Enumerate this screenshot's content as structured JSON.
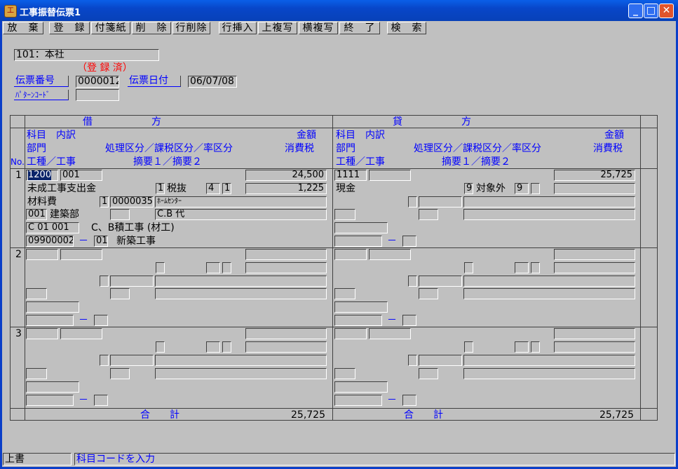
{
  "window": {
    "title": "工事振替伝票1",
    "app_icon_glyph": "工"
  },
  "toolbar": [
    "放　棄",
    "登　録",
    "付箋紙",
    "削　除",
    "行削除",
    "行挿入",
    "上複写",
    "横複写",
    "終　了",
    "検　索"
  ],
  "header": {
    "company": "101：本社",
    "status": "（登 録 済）",
    "slip_no_label": "伝票番号",
    "slip_no": "0000012",
    "slip_date_label": "伝票日付",
    "slip_date": "06/07/08",
    "pattern_code_label": "ﾊﾟﾀｰﾝｺｰﾄﾞ",
    "pattern_code": ""
  },
  "columns": {
    "debit": "借　　　　　　方",
    "credit": "貸　　　　　　方",
    "no": "No.",
    "row1_left": "科目　内訳",
    "row1_right": "金額",
    "row2_left": "部門",
    "row2_mid": "処理区分／課税区分／率区分",
    "row2_right": "消費税",
    "row3_left": "工種／工事",
    "row3_mid": "摘要１／摘要２"
  },
  "rows": [
    {
      "no": "1",
      "debit": {
        "account": "1200",
        "breakdown": "001",
        "amount": "24,500",
        "account_name": "未成工事支出金",
        "proc_code": "1",
        "proc_name": "税抜",
        "tax_code": "4",
        "rate_code": "1",
        "tax": "1,225",
        "sub_name": "材料費",
        "sub_flag": "1",
        "vendor_code": "0000035",
        "vendor_name": "ﾎｰﾑｾﾝﾀｰ",
        "dept_code": "001",
        "dept_name": "建築部",
        "memo1": "C.B 代",
        "work_type_code": "C 01 001",
        "work_type_name": "C、B積工事 (材工)",
        "project_code": "09900002",
        "dash": "－",
        "project_sub": "01",
        "project_name": "新築工事"
      },
      "credit": {
        "account": "1111",
        "breakdown": "",
        "amount": "25,725",
        "account_name": "現金",
        "proc_code": "9",
        "proc_name": "対象外",
        "tax_code": "9",
        "dash": "－"
      }
    },
    {
      "no": "2",
      "debit": {
        "dash": "－"
      },
      "credit": {
        "dash": "－"
      }
    },
    {
      "no": "3",
      "debit": {
        "dash": "－"
      },
      "credit": {
        "dash": "－"
      }
    }
  ],
  "totals": {
    "label": "合　　計",
    "debit_total": "25,725",
    "credit_total": "25,725"
  },
  "statusbar": {
    "mode": "上書",
    "message": "科目コードを入力"
  }
}
